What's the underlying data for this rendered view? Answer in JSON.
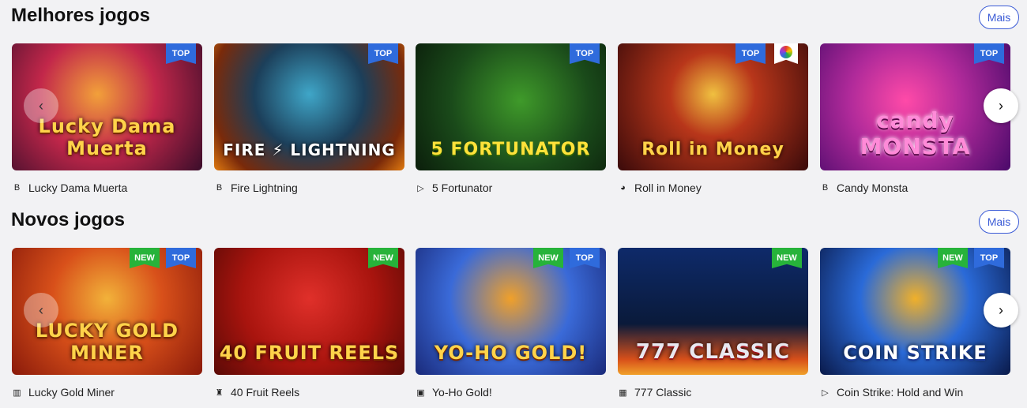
{
  "sections": [
    {
      "title": "Melhores jogos",
      "more_label": "Mais",
      "games": [
        {
          "name": "Lucky Dama Muerta",
          "art_text": "Lucky Dama Muerta",
          "badges": [
            "TOP"
          ],
          "provider_icon": "B"
        },
        {
          "name": "Fire Lightning",
          "art_text": "FIRE ⚡ LIGHTNING",
          "badges": [
            "TOP"
          ],
          "provider_icon": "B"
        },
        {
          "name": "5 Fortunator",
          "art_text": "5 FORTUNATOR",
          "badges": [
            "TOP"
          ],
          "provider_icon": "▷"
        },
        {
          "name": "Roll in Money",
          "art_text": "Roll in Money",
          "badges": [
            "TOP"
          ],
          "provider_icon": "◕"
        },
        {
          "name": "Candy Monsta",
          "art_text": "candy MONSTA",
          "badges": [
            "TOP"
          ],
          "provider_icon": "B"
        }
      ]
    },
    {
      "title": "Novos jogos",
      "more_label": "Mais",
      "games": [
        {
          "name": "Lucky Gold Miner",
          "art_text": "LUCKY GOLD MINER",
          "badges": [
            "NEW",
            "TOP"
          ],
          "provider_icon": "▥"
        },
        {
          "name": "40 Fruit Reels",
          "art_text": "40 FRUIT REELS",
          "badges": [
            "NEW"
          ],
          "provider_icon": "♜"
        },
        {
          "name": "Yo-Ho Gold!",
          "art_text": "YO-HO GOLD!",
          "badges": [
            "NEW",
            "TOP"
          ],
          "provider_icon": "▣"
        },
        {
          "name": "777 Classic",
          "art_text": "777 CLASSIC",
          "badges": [
            "NEW"
          ],
          "provider_icon": "▦"
        },
        {
          "name": "Coin Strike: Hold and Win",
          "art_text": "COIN STRIKE",
          "badges": [
            "NEW",
            "TOP"
          ],
          "provider_icon": "▷"
        }
      ]
    }
  ],
  "colors": {
    "accent": "#3b5bd6",
    "badge_top": "#2f6bdc",
    "badge_new": "#27b33a"
  },
  "icons": {
    "prev": "‹",
    "next": "›"
  }
}
